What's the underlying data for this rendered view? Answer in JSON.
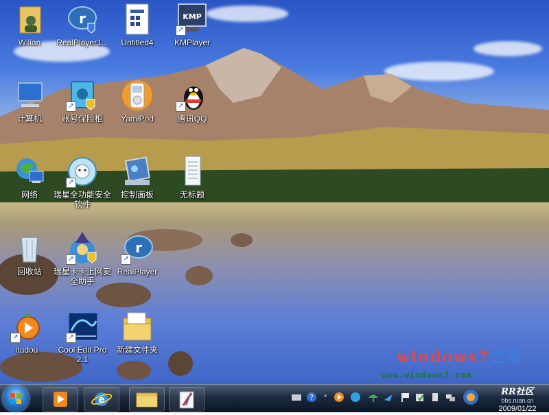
{
  "desktop": {
    "icons": [
      {
        "label": "Wilian",
        "icon": "user-folder-icon"
      },
      {
        "label": "RealPlayer1...",
        "icon": "realplayer-icon"
      },
      {
        "label": "Untitled4",
        "icon": "document-icon"
      },
      {
        "label": "KMPlayer",
        "icon": "kmplayer-icon",
        "badge": "KMP"
      },
      {
        "label": "计算机",
        "icon": "computer-icon"
      },
      {
        "label": "账号保险柜",
        "icon": "safe-icon"
      },
      {
        "label": "YamiPod",
        "icon": "ipod-icon"
      },
      {
        "label": "腾讯QQ",
        "icon": "qq-penguin-icon"
      },
      {
        "label": "网络",
        "icon": "network-icon"
      },
      {
        "label": "瑞星全功能安全软件",
        "icon": "rising-lion-icon"
      },
      {
        "label": "控制面板",
        "icon": "control-panel-icon"
      },
      {
        "label": "无标题",
        "icon": "text-file-icon"
      },
      {
        "label": "回收站",
        "icon": "recycle-bin-icon"
      },
      {
        "label": "瑞星卡卡上网安全助手",
        "icon": "kaka-wizard-icon"
      },
      {
        "label": "RealPlayer",
        "icon": "realplayer-icon"
      },
      {
        "label": "itudou",
        "icon": "itudou-icon"
      },
      {
        "label": "Cool Edit Pro 2.1",
        "icon": "cool-edit-icon"
      },
      {
        "label": "新建文件夹",
        "icon": "folder-icon"
      }
    ]
  },
  "watermark": {
    "logo_text": "windows7",
    "logo_suffix": "之家",
    "url": "www.windows7.com"
  },
  "taskbar": {
    "pinned": [
      {
        "name": "media-player-button",
        "icon": "media-player-icon"
      },
      {
        "name": "ie-button",
        "icon": "internet-explorer-icon"
      },
      {
        "name": "explorer-button",
        "icon": "file-explorer-icon"
      },
      {
        "name": "paint-button",
        "icon": "paint-icon"
      }
    ],
    "clock": {
      "logo": "RR社区",
      "site": "bbs.ruan.cn",
      "date": "2009/01/22"
    }
  },
  "colors": {
    "taskbar": "#1c2a40",
    "watermark_red": "#e8473f",
    "watermark_blue": "#3c7de0",
    "watermark_green": "#1a7a2a"
  }
}
